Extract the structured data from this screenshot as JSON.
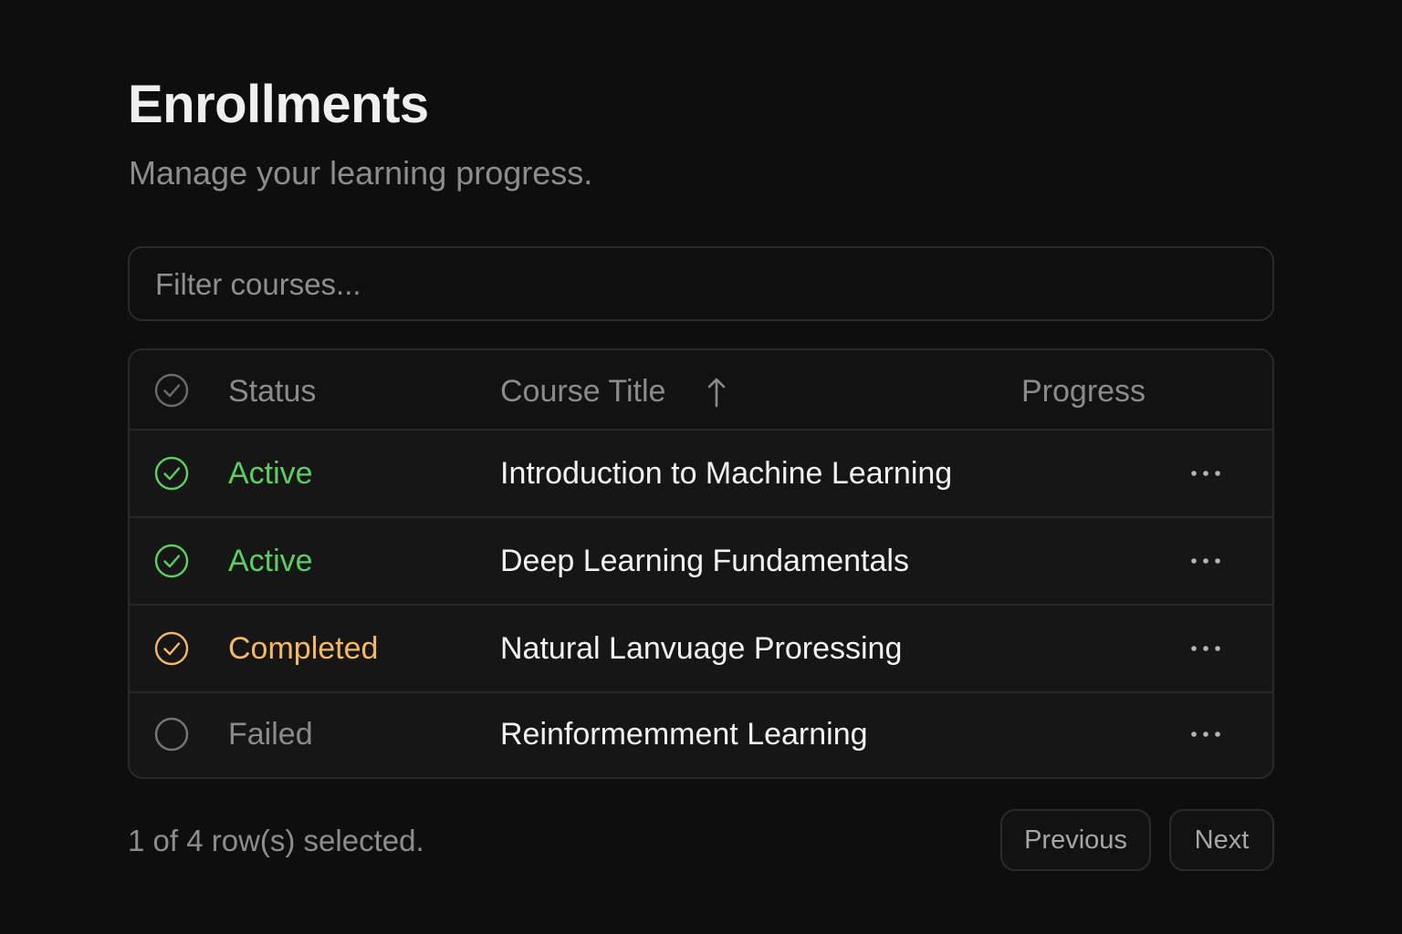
{
  "page": {
    "title": "Enrollments",
    "subtitle": "Manage your learning progress."
  },
  "filter": {
    "placeholder": "Filter courses...",
    "value": ""
  },
  "table": {
    "columns": {
      "status": "Status",
      "course_title": "Course Title",
      "progress": "Progress"
    },
    "sort": {
      "column": "Course Title",
      "direction": "ascending",
      "icon": "arrow-up-icon"
    },
    "rows": [
      {
        "status": "Active",
        "course_title": "Introduction to Machine Learning",
        "checked": true,
        "status_color": "#5bd05e",
        "actions_icon": "more-horizontal-icon"
      },
      {
        "status": "Active",
        "course_title": "Deep Learning Fundamentals",
        "checked": true,
        "status_color": "#5bd05e",
        "actions_icon": "more-horizontal-icon"
      },
      {
        "status": "Completed",
        "course_title": "Natural Lanvuage Proressing",
        "checked": true,
        "status_color": "#f5b867",
        "actions_icon": "more-horizontal-icon"
      },
      {
        "status": "Failed",
        "course_title": "Reinformemment Learning",
        "checked": false,
        "status_color": "#8b8b8b",
        "actions_icon": "more-horizontal-icon"
      }
    ]
  },
  "footer": {
    "selection_text": "1 of 4 row(s) selected.",
    "previous_label": "Previous",
    "next_label": "Next"
  },
  "colors": {
    "background": "#0e0e0e",
    "active": "#5bd05e",
    "completed": "#f5b867",
    "muted": "#8b8b8b"
  }
}
